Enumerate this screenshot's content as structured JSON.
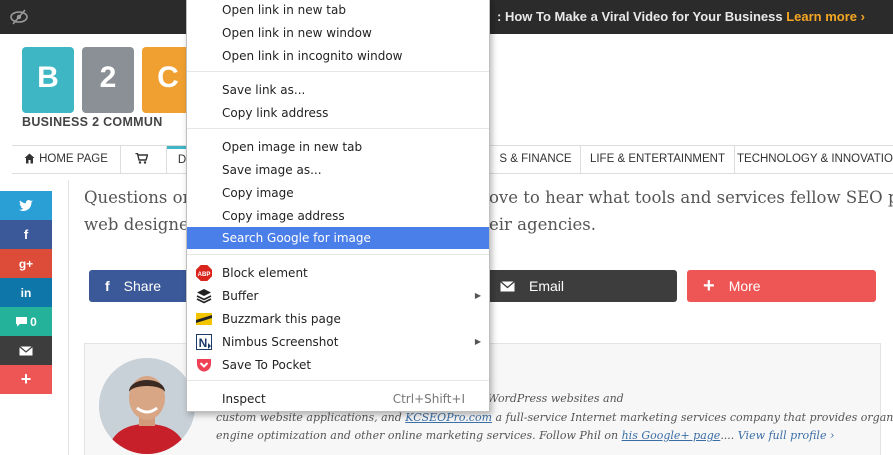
{
  "banner": {
    "text": ": How To Make a Viral Video for Your Business ",
    "link": "Learn more ›"
  },
  "logo": {
    "letters": [
      "B",
      "2",
      "C"
    ],
    "tagline": "BUSINESS 2 COMMUN"
  },
  "nav": {
    "home": "HOME PAGE",
    "partial_d": "D",
    "finance_partial": "S & FINANCE",
    "life": "LIFE & ENTERTAINMENT",
    "tech": "TECHNOLOGY & INNOVATION"
  },
  "sidebar": {
    "twitter": "",
    "facebook": "f",
    "gplus": "g+",
    "linkedin": "in",
    "comment_count": "0",
    "email": "",
    "more": "+"
  },
  "intro": {
    "line1_left": "Questions or c",
    "line1_right": "ove to hear what tools and services fellow SEO pros,",
    "line2_left": "web designers",
    "line2_right": "eir agencies."
  },
  "sharebar": {
    "share": "Share",
    "email": "Email",
    "more": "More"
  },
  "bio": {
    "line1": "b development firm specializing in SEO-friendly WordPress websites and",
    "line2_a": "custom website applications, and ",
    "line2_link": "KCSEOPro.com",
    "line2_b": " a full-service Internet marketing services company that provides organic search",
    "line3_a": "engine optimization and other online marketing services.  Follow Phil on ",
    "line3_link": "his Google+ page",
    "line3_b": ".... ",
    "line3_profile": "View full profile ›"
  },
  "context_menu": {
    "open_new_tab": "Open link in new tab",
    "open_new_window": "Open link in new window",
    "open_incognito": "Open link in incognito window",
    "save_link": "Save link as...",
    "copy_link": "Copy link address",
    "open_image": "Open image in new tab",
    "save_image": "Save image as...",
    "copy_image": "Copy image",
    "copy_image_address": "Copy image address",
    "search_google": "Search Google for image",
    "block_element": "Block element",
    "buffer": "Buffer",
    "buzzmark": "Buzzmark this page",
    "nimbus": "Nimbus Screenshot",
    "pocket": "Save To Pocket",
    "inspect": "Inspect",
    "inspect_shortcut": "Ctrl+Shift+I"
  },
  "colors": {
    "twitter": "#2a9fd6",
    "facebook": "#3b5998",
    "gplus": "#dd4b39",
    "linkedin": "#0e76a8",
    "comments": "#24b29a",
    "email": "#3d3d3d",
    "more": "#ee5555",
    "highlight": "#4a7ee8",
    "banner_link": "#f5a623"
  }
}
